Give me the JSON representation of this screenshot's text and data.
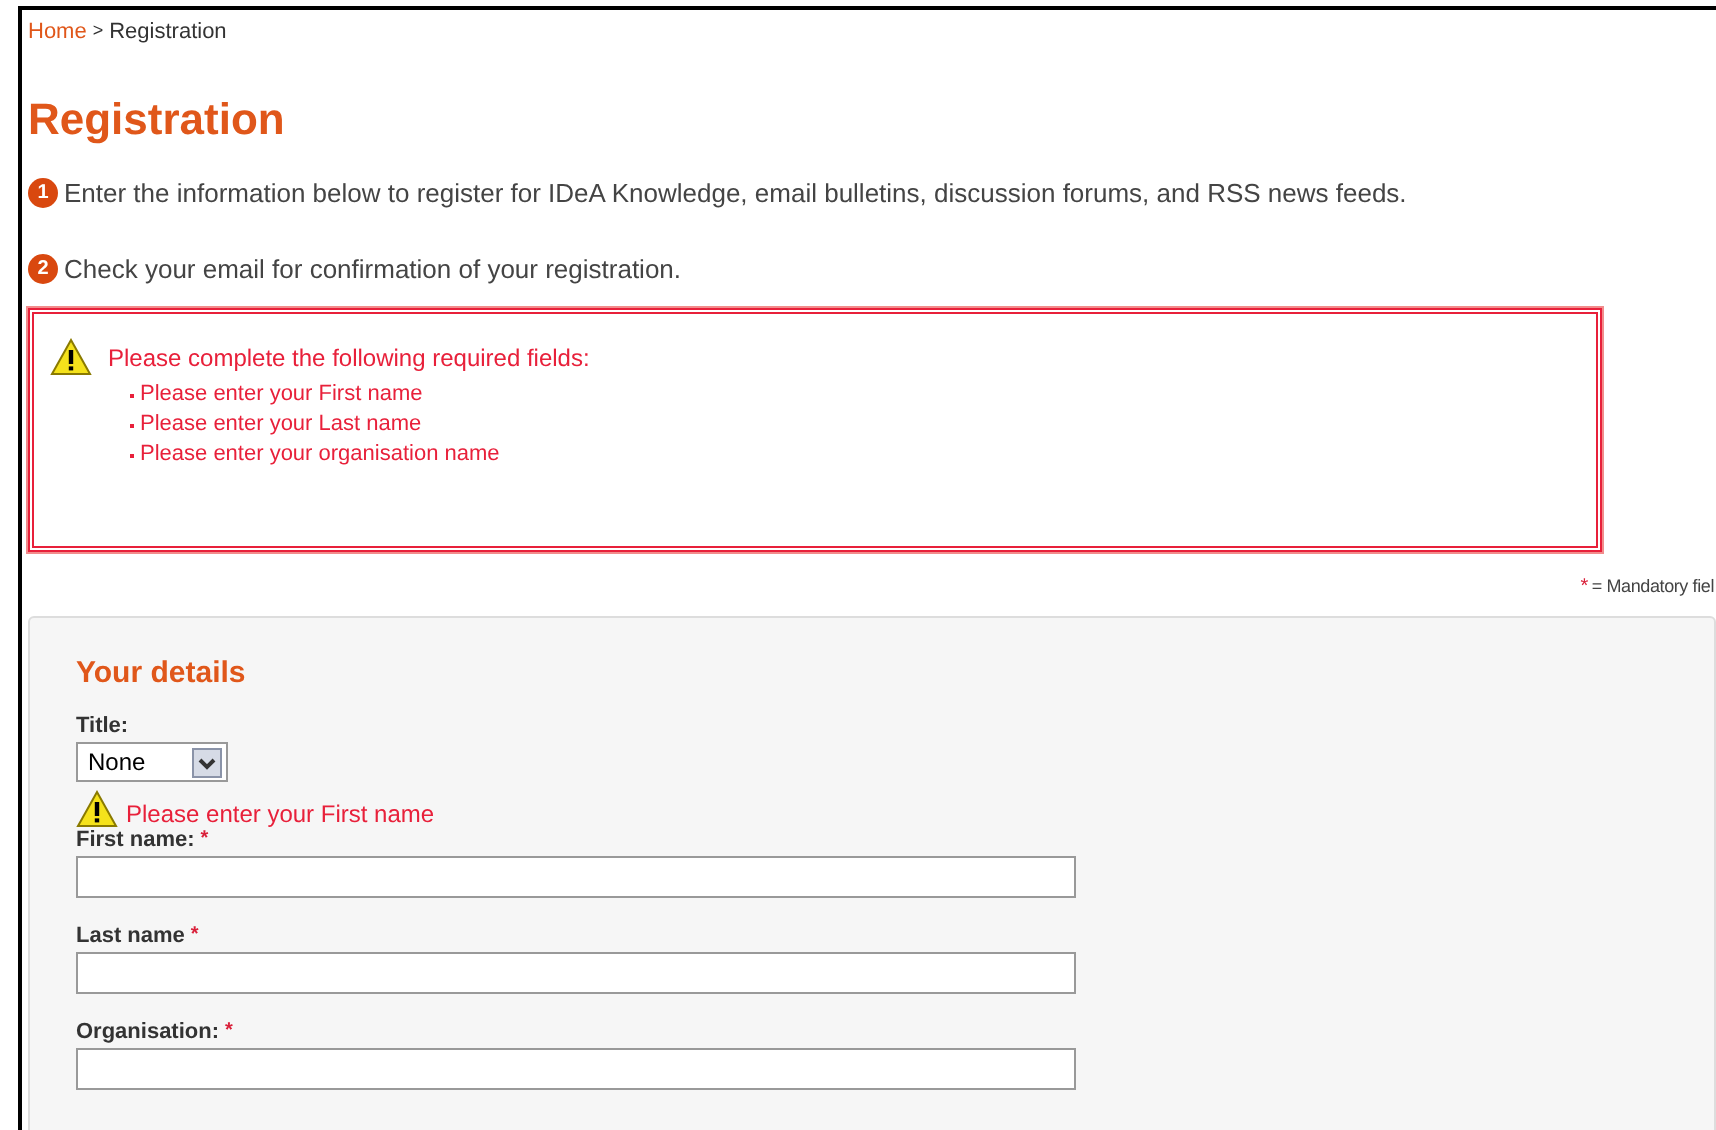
{
  "breadcrumb": {
    "home": "Home",
    "separator": ">",
    "current": "Registration"
  },
  "title": "Registration",
  "steps": [
    {
      "number": "1",
      "text": "Enter the information below to register for IDeA Knowledge, email bulletins, discussion forums, and RSS news feeds."
    },
    {
      "number": "2",
      "text": "Check your email for confirmation of your registration."
    }
  ],
  "error_box": {
    "heading": "Please complete the following required fields:",
    "items": [
      "Please enter your First name",
      "Please enter your Last name",
      "Please enter your organisation name"
    ]
  },
  "mandatory_note": {
    "mark": "*",
    "text": "= Mandatory fiel"
  },
  "section": {
    "heading": "Your details",
    "title_field": {
      "label": "Title:",
      "value": "None"
    },
    "fields": [
      {
        "label": "First name:",
        "required": true,
        "error": "Please enter your First name"
      },
      {
        "label": "Last name",
        "required": true
      },
      {
        "label": "Organisation:",
        "required": true
      }
    ]
  }
}
